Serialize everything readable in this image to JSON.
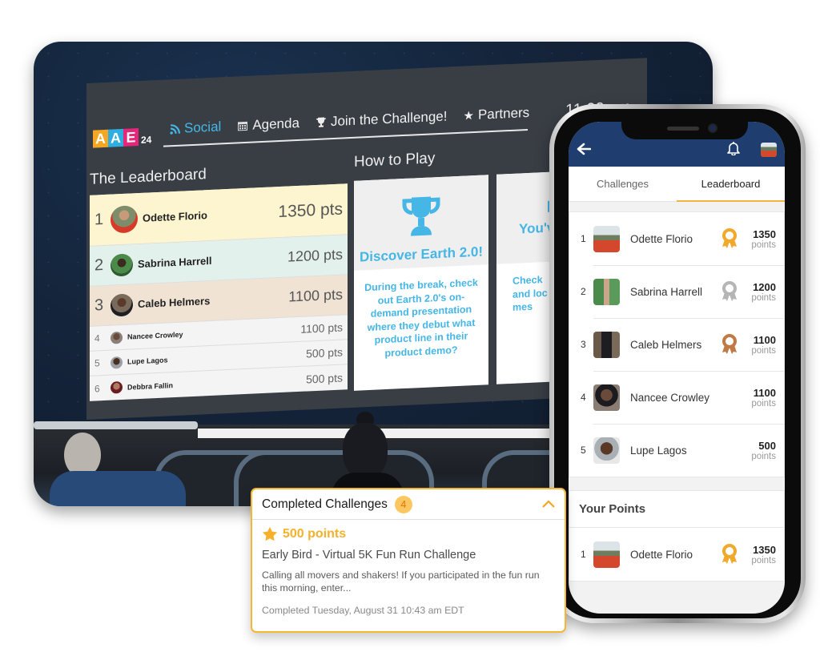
{
  "board": {
    "logo": {
      "letters": [
        "A",
        "A",
        "E"
      ],
      "year": "24"
    },
    "nav": [
      {
        "label": "Social",
        "icon": "rss-icon",
        "active": true
      },
      {
        "label": "Agenda",
        "icon": "calendar-icon",
        "active": false
      },
      {
        "label": "Join the Challenge!",
        "icon": "trophy-icon",
        "active": false
      },
      {
        "label": "Partners",
        "icon": "star-icon",
        "active": false
      }
    ],
    "clock": "11:00 am",
    "leaderboard_title": "The Leaderboard",
    "how_to_play_title": "How to Play",
    "leaderboard": [
      {
        "rank": "1",
        "name": "Odette Florio",
        "points": "1350 pts"
      },
      {
        "rank": "2",
        "name": "Sabrina Harrell",
        "points": "1200 pts"
      },
      {
        "rank": "3",
        "name": "Caleb Helmers",
        "points": "1100 pts"
      },
      {
        "rank": "4",
        "name": "Nancee Crowley",
        "points": "1100 pts"
      },
      {
        "rank": "5",
        "name": "Lupe Lagos",
        "points": "500 pts"
      },
      {
        "rank": "6",
        "name": "Debbra Fallin",
        "points": "500 pts"
      }
    ],
    "cards": [
      {
        "title": "Discover Earth 2.0!",
        "body": "During the break, check out Earth 2.0's on-demand presentation where they debut what product line in their product demo?"
      },
      {
        "title": "You'v",
        "body": "Check and loc mes"
      }
    ]
  },
  "phone": {
    "tabs": [
      {
        "label": "Challenges",
        "active": false
      },
      {
        "label": "Leaderboard",
        "active": true
      }
    ],
    "leaderboard": [
      {
        "rank": "1",
        "name": "Odette Florio",
        "points": "1350",
        "unit": "points",
        "medal": "gold"
      },
      {
        "rank": "2",
        "name": "Sabrina Harrell",
        "points": "1200",
        "unit": "points",
        "medal": "silver"
      },
      {
        "rank": "3",
        "name": "Caleb Helmers",
        "points": "1100",
        "unit": "points",
        "medal": "bronze"
      },
      {
        "rank": "4",
        "name": "Nancee Crowley",
        "points": "1100",
        "unit": "points",
        "medal": ""
      },
      {
        "rank": "5",
        "name": "Lupe Lagos",
        "points": "500",
        "unit": "points",
        "medal": ""
      }
    ],
    "your_points": {
      "title": "Your Points",
      "entry": {
        "rank": "1",
        "name": "Odette Florio",
        "points": "1350",
        "unit": "points",
        "medal": "gold"
      }
    }
  },
  "completed": {
    "title": "Completed Challenges",
    "count": "4",
    "points": "500 points",
    "challenge_name": "Early Bird - Virtual 5K Fun Run Challenge",
    "description": "Calling all movers and shakers! If you participated in the fun run this morning, enter...",
    "completed_at": "Completed Tuesday, August 31 10:43 am EDT"
  },
  "colors": {
    "accent_blue": "#45b6e6",
    "app_bar": "#1f3d6e",
    "gold": "#f0a92a",
    "silver": "#b5b5b5",
    "bronze": "#c07a45",
    "highlight": "#f5b731"
  }
}
